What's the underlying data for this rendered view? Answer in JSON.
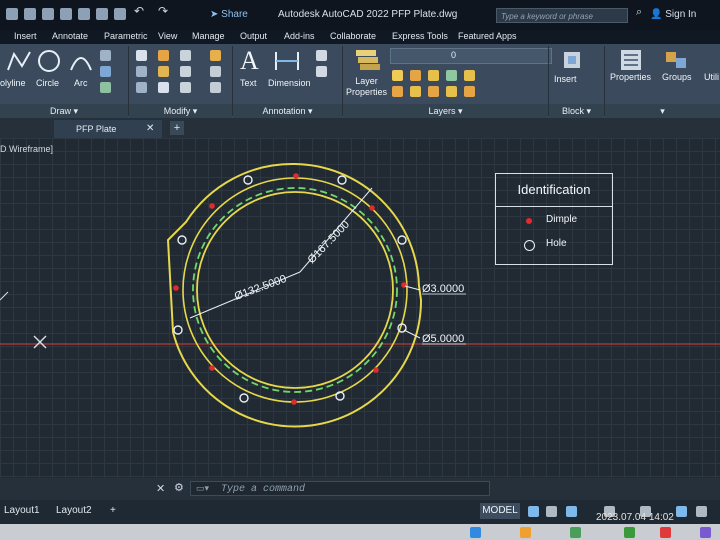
{
  "titlebar": {
    "app_title": "Autodesk AutoCAD 2022   PFP Plate.dwg",
    "share": "Share",
    "search_placeholder": "Type a keyword or phrase",
    "sign_in": "Sign In"
  },
  "menu": [
    "Insert",
    "Annotate",
    "Parametric",
    "View",
    "Manage",
    "Output",
    "Add-ins",
    "Collaborate",
    "Express Tools",
    "Featured Apps"
  ],
  "ribbon": {
    "tools": {
      "polyline": "olyline",
      "circle": "Circle",
      "arc": "Arc",
      "text": "Text",
      "dimension": "Dimension",
      "layer_properties": "Layer\nProperties",
      "insert": "Insert",
      "properties": "Properties",
      "groups": "Groups",
      "utilities": "Utili"
    },
    "panels": {
      "draw": "Draw",
      "modify": "Modify",
      "annotation": "Annotation",
      "layers": "Layers",
      "block": "Block"
    },
    "layer_value": "0"
  },
  "file_tab": "PFP Plate",
  "view_label": "D Wireframe]",
  "drawing": {
    "dims": [
      "Ø167.5000",
      "Ø132.5000",
      "Ø3.0000",
      "Ø5.0000"
    ]
  },
  "legend": {
    "title": "Identification",
    "items": [
      {
        "label": "Dimple",
        "symbol": "red-dot"
      },
      {
        "label": "Hole",
        "symbol": "circle"
      }
    ]
  },
  "command": {
    "placeholder": "Type a command"
  },
  "status": {
    "layouts": [
      "Layout1",
      "Layout2"
    ],
    "model": "MODEL",
    "timestamp": "2023.07.04  14:02"
  },
  "colors": {
    "yellow": "#e6d84a",
    "green_dashed": "#6fd86a",
    "red": "#e12c2c",
    "ortho_line": "#b63a3a"
  }
}
